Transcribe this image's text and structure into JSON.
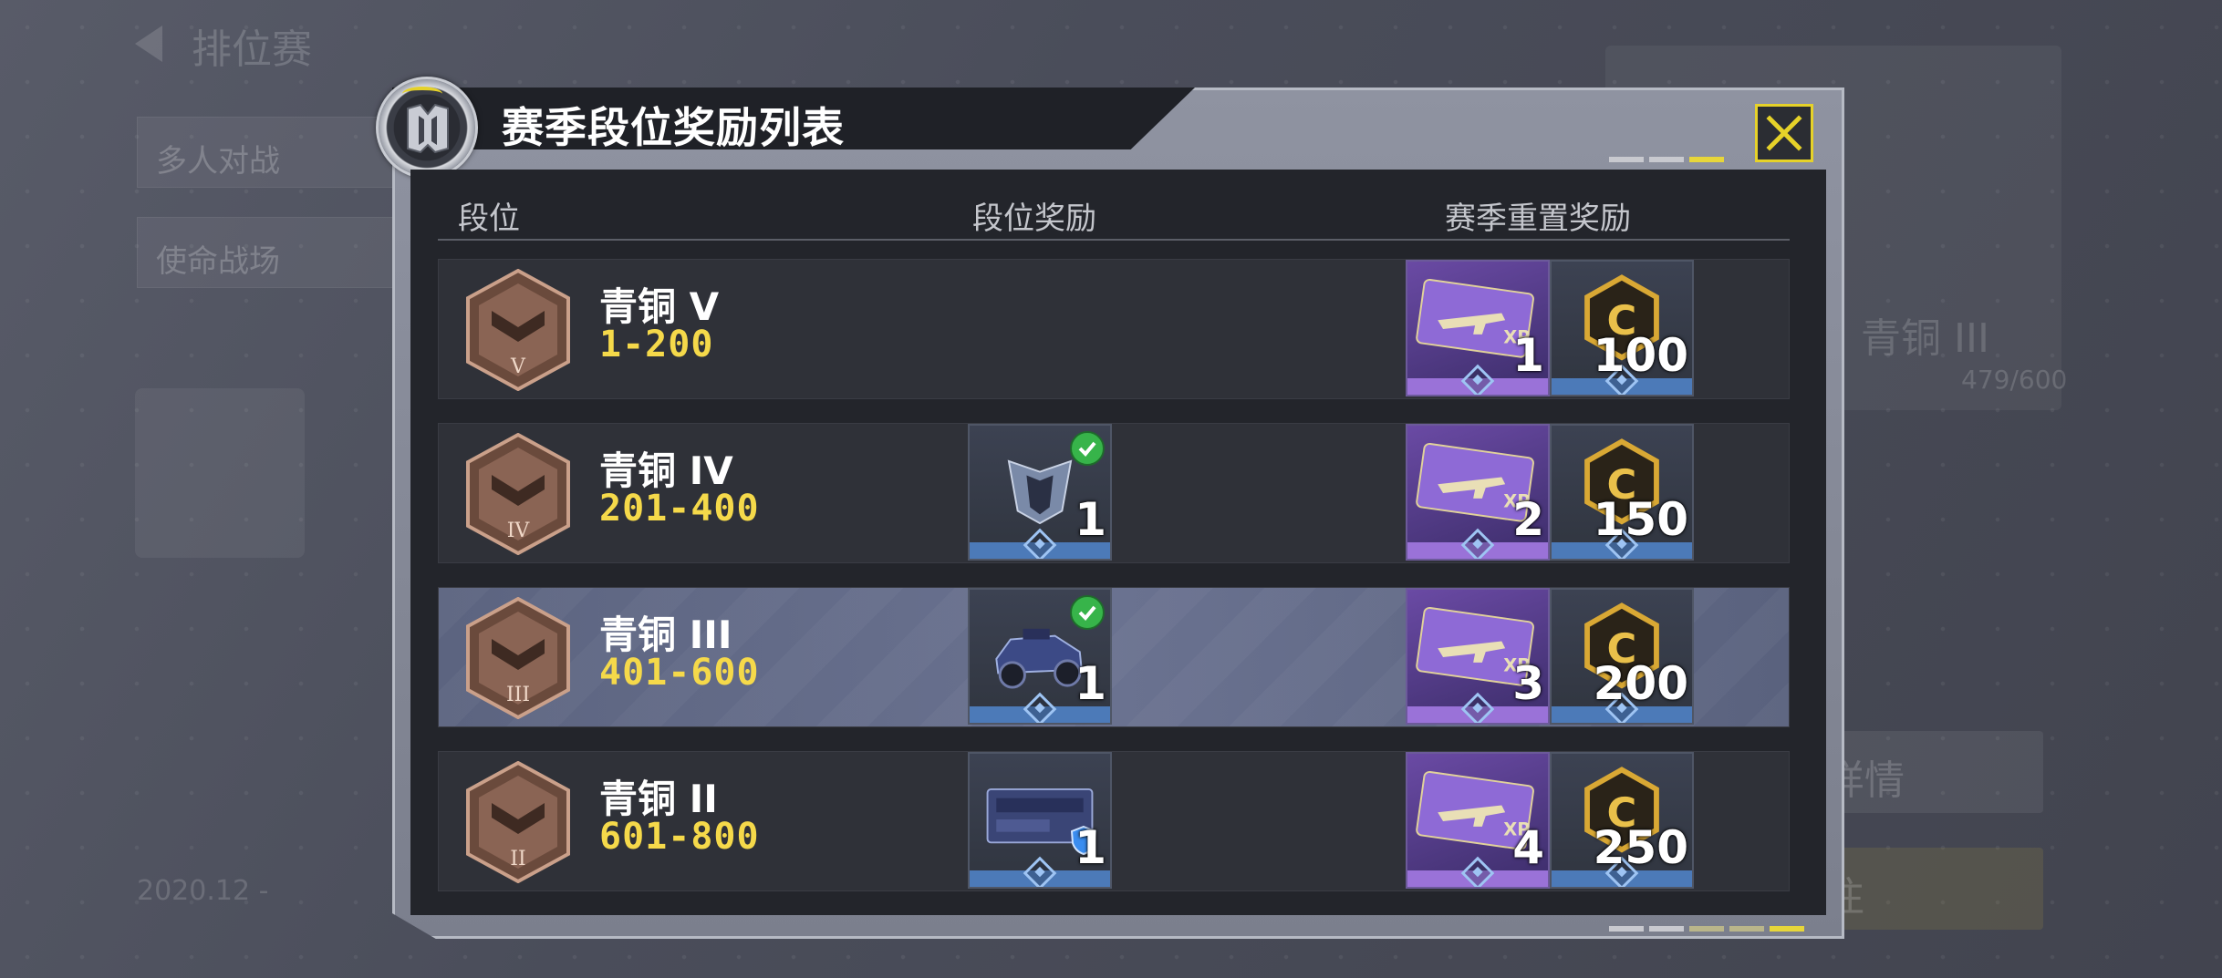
{
  "background": {
    "mode_title": "排位赛",
    "menu_items": [
      "多人对战",
      "使命战场"
    ],
    "rank_text": "青铜 III",
    "progress_text": "479/600",
    "detail_button": "详情",
    "go_button": "往",
    "season_text": "2020.12 -"
  },
  "dialog": {
    "title": "赛季段位奖励列表",
    "columns": {
      "rank": "段位",
      "rank_reward": "段位奖励",
      "reset_reward": "赛季重置奖励"
    },
    "rows": [
      {
        "rank": "青铜 V",
        "numeral": "V",
        "range": "1-200",
        "rank_reward": null,
        "xp_ticket_count": "1",
        "cp_amount": "100",
        "active": false
      },
      {
        "rank": "青铜 IV",
        "numeral": "IV",
        "range": "201-400",
        "rank_reward": {
          "icon": "emblem-icon",
          "count": "1",
          "claimed": true
        },
        "xp_ticket_count": "2",
        "cp_amount": "150",
        "active": false
      },
      {
        "rank": "青铜 III",
        "numeral": "III",
        "range": "401-600",
        "rank_reward": {
          "icon": "vehicle-skin-icon",
          "count": "1",
          "claimed": true
        },
        "xp_ticket_count": "3",
        "cp_amount": "200",
        "active": true
      },
      {
        "rank": "青铜 II",
        "numeral": "II",
        "range": "601-800",
        "rank_reward": {
          "icon": "weapon-crate-icon",
          "count": "1",
          "claimed": false
        },
        "xp_ticket_count": "4",
        "cp_amount": "250",
        "active": false
      }
    ]
  },
  "colors": {
    "accent_yellow": "#e6d229",
    "range_yellow": "#f5d94a",
    "claimed_green": "#37b44a",
    "active_row": "#646c8a"
  }
}
